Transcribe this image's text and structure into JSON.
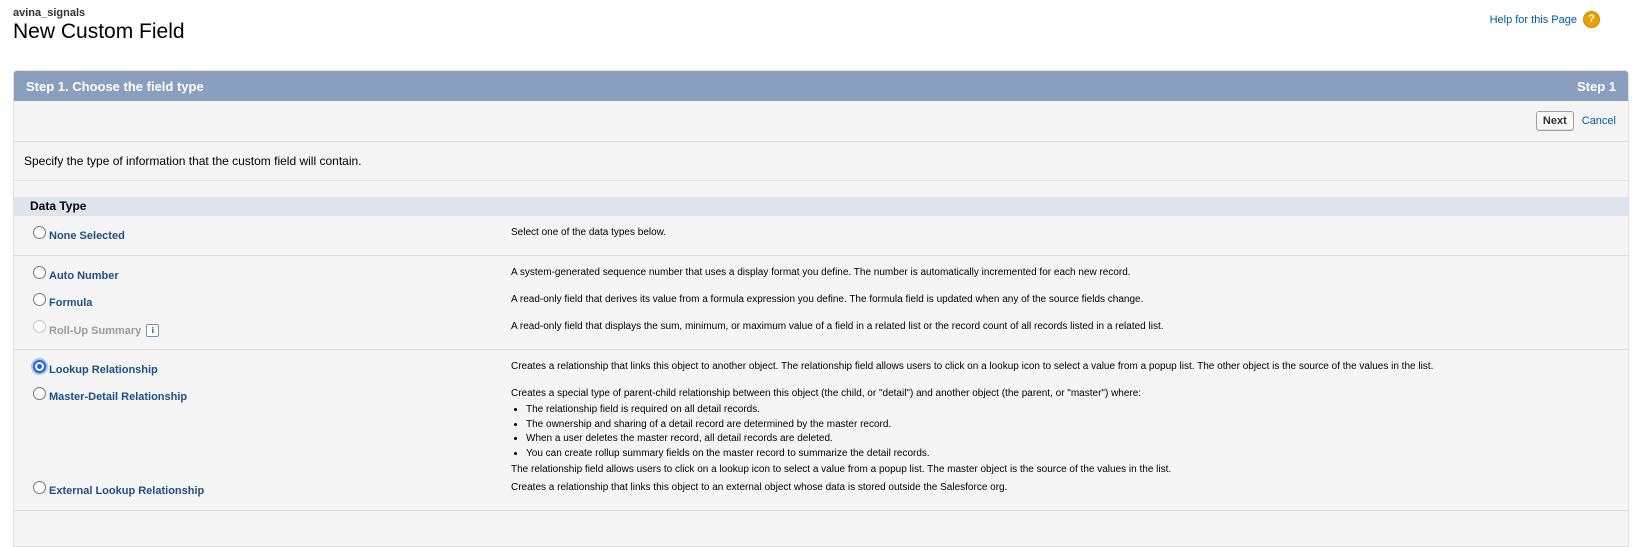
{
  "header": {
    "object_name": "avina_signals",
    "title": "New Custom Field",
    "help_link": "Help for this Page",
    "help_icon": "?"
  },
  "step": {
    "title": "Step 1. Choose the field type",
    "indicator": "Step 1"
  },
  "buttons": {
    "next": "Next",
    "cancel": "Cancel"
  },
  "intro": "Specify the type of information that the custom field will contain.",
  "data_type_section": {
    "title": "Data Type",
    "selected": "Lookup Relationship",
    "groups": [
      [
        {
          "label": "None Selected",
          "description": "Select one of the data types below.",
          "disabled": false,
          "checked": false
        }
      ],
      [
        {
          "label": "Auto Number",
          "description": "A system-generated sequence number that uses a display format you define. The number is automatically incremented for each new record.",
          "disabled": false,
          "checked": false
        },
        {
          "label": "Formula",
          "description": "A read-only field that derives its value from a formula expression you define. The formula field is updated when any of the source fields change.",
          "disabled": false,
          "checked": false
        },
        {
          "label": "Roll-Up Summary",
          "description": "A read-only field that displays the sum, minimum, or maximum value of a field in a related list or the record count of all records listed in a related list.",
          "disabled": true,
          "checked": false,
          "info_icon": "i"
        }
      ],
      [
        {
          "label": "Lookup Relationship",
          "description": "Creates a relationship that links this object to another object. The relationship field allows users to click on a lookup icon to select a value from a popup list. The other object is the source of the values in the list.",
          "disabled": false,
          "checked": true
        },
        {
          "label": "Master-Detail Relationship",
          "description": "Creates a special type of parent-child relationship between this object (the child, or \"detail\") and another object (the parent, or \"master\") where:",
          "bullets": [
            "The relationship field is required on all detail records.",
            "The ownership and sharing of a detail record are determined by the master record.",
            "When a user deletes the master record, all detail records are deleted.",
            "You can create rollup summary fields on the master record to summarize the detail records."
          ],
          "description_footer": "The relationship field allows users to click on a lookup icon to select a value from a popup list. The master object is the source of the values in the list.",
          "disabled": false,
          "checked": false
        },
        {
          "label": "External Lookup Relationship",
          "description": "Creates a relationship that links this object to an external object whose data is stored outside the Salesforce org.",
          "disabled": false,
          "checked": false
        }
      ]
    ]
  }
}
